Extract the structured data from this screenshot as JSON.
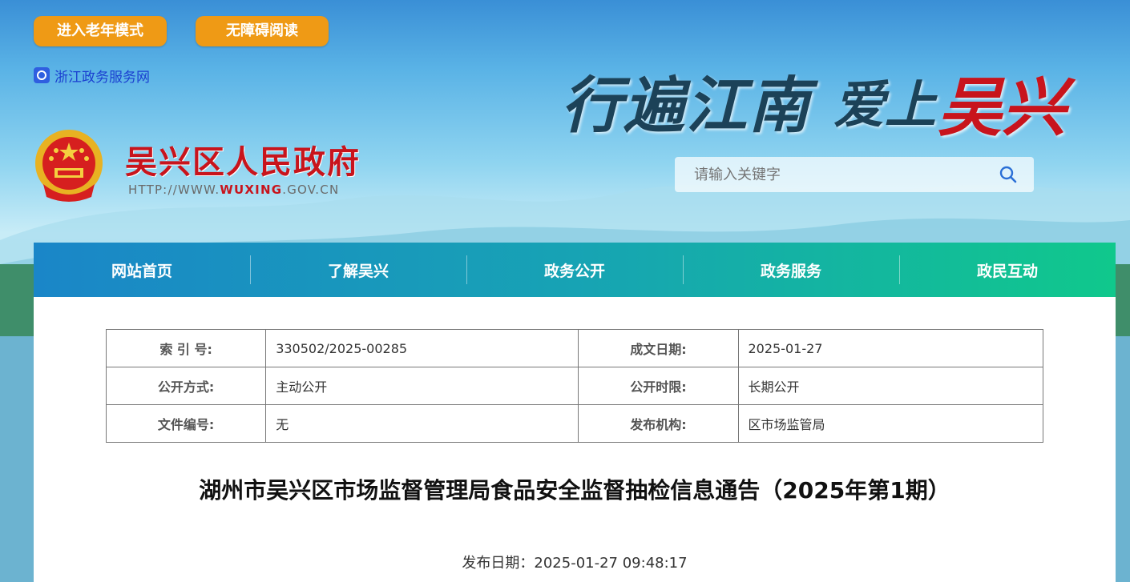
{
  "header": {
    "elder_mode_label": "进入老年模式",
    "accessible_label": "无障碍阅读",
    "zj_link_label": "浙江政务服务网",
    "site_name": "吴兴区人民政府",
    "site_url_prefix": "HTTP://WWW.",
    "site_url_domain": "WUXING",
    "site_url_suffix": ".GOV.CN",
    "slogan_part1": "行遍江南",
    "slogan_part2": "爱上",
    "slogan_part3": "吴兴",
    "search_placeholder": "请输入关键字"
  },
  "nav": {
    "items": [
      "网站首页",
      "了解吴兴",
      "政务公开",
      "政务服务",
      "政民互动"
    ]
  },
  "meta": {
    "index_label": "索 引 号:",
    "index_value": "330502/2025-00285",
    "date_label": "成文日期:",
    "date_value": "2025-01-27",
    "method_label": "公开方式:",
    "method_value": "主动公开",
    "period_label": "公开时限:",
    "period_value": "长期公开",
    "docno_label": "文件编号:",
    "docno_value": "无",
    "org_label": "发布机构:",
    "org_value": "区市场监管局"
  },
  "article": {
    "title": "湖州市吴兴区市场监督管理局食品安全监督抽检信息通告（2025年第1期）",
    "pubdate": "发布日期：2025-01-27 09:48:17"
  },
  "colors": {
    "accent_orange": "#ef9a15",
    "site_red": "#c8141c",
    "nav_start": "#1a86c8",
    "nav_end": "#10c88c"
  }
}
